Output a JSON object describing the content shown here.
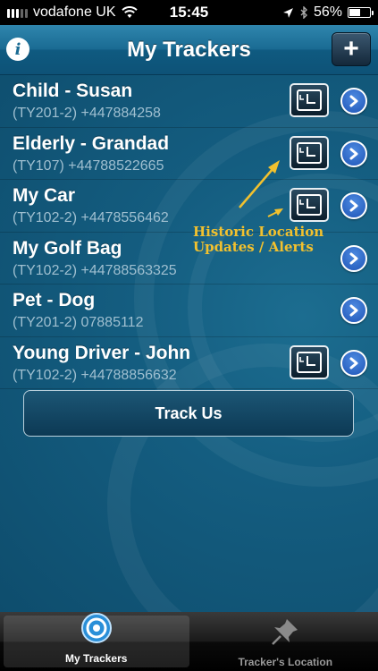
{
  "status_bar": {
    "carrier": "vodafone UK",
    "time": "15:45",
    "battery": "56%",
    "battery_level": 0.56
  },
  "nav": {
    "title": "My Trackers",
    "info_label": "i",
    "add_label": "+"
  },
  "trackers": [
    {
      "name": "Child - Susan",
      "detail": "(TY201-2) +447884258",
      "history": true
    },
    {
      "name": "Elderly - Grandad",
      "detail": "(TY107) +44788522665",
      "history": true
    },
    {
      "name": "My Car",
      "detail": "(TY102-2) +4478556462",
      "history": true
    },
    {
      "name": "My Golf Bag",
      "detail": "(TY102-2) +44788563325",
      "history": false
    },
    {
      "name": "Pet - Dog",
      "detail": "(TY201-2) 07885112",
      "history": false
    },
    {
      "name": "Young Driver - John",
      "detail": "(TY102-2) +44788856632",
      "history": true
    }
  ],
  "track_us_label": "Track Us",
  "annotation": {
    "line1": "Historic Location",
    "line2": "Updates / Alerts",
    "color": "#f2c12e"
  },
  "tabs": [
    {
      "label": "My Trackers",
      "icon": "target-icon",
      "active": true
    },
    {
      "label": "Tracker's Location",
      "icon": "pushpin-icon",
      "active": false
    }
  ]
}
